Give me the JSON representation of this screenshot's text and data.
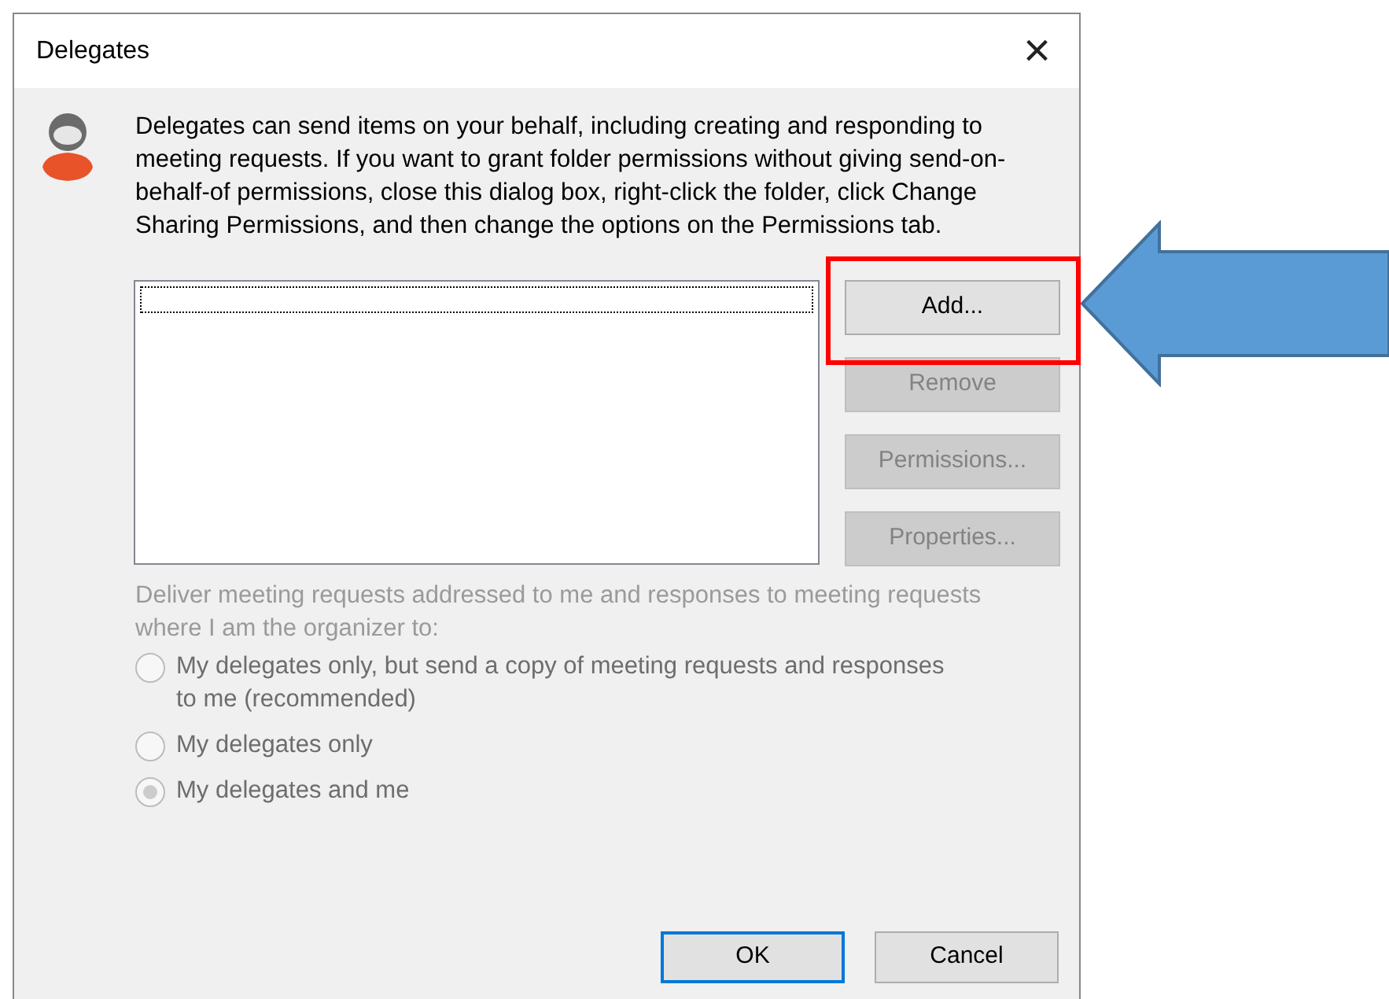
{
  "window": {
    "title": "Delegates",
    "close": "×"
  },
  "description": "Delegates can send items on your behalf, including creating and responding to meeting requests. If you want to grant folder permissions without giving send-on-behalf-of permissions, close this dialog box, right-click the folder, click Change Sharing Permissions, and then change the options on the Permissions tab.",
  "side_buttons": [
    {
      "label": "Add...",
      "disabled": false
    },
    {
      "label": "Remove",
      "disabled": true
    },
    {
      "label": "Permissions...",
      "disabled": true
    },
    {
      "label": "Properties...",
      "disabled": true
    }
  ],
  "delivery": {
    "label": "Deliver meeting requests addressed to me and responses to meeting requests where I am the organizer to:",
    "disabled": true,
    "options": [
      {
        "label": "My delegates only, but send a copy of meeting requests and responses to me (recommended)",
        "selected": false
      },
      {
        "label": "My delegates only",
        "selected": false
      },
      {
        "label": "My delegates and me",
        "selected": true
      }
    ]
  },
  "footer_buttons": [
    {
      "label": "OK",
      "default": true
    },
    {
      "label": "Cancel",
      "default": false
    }
  ]
}
